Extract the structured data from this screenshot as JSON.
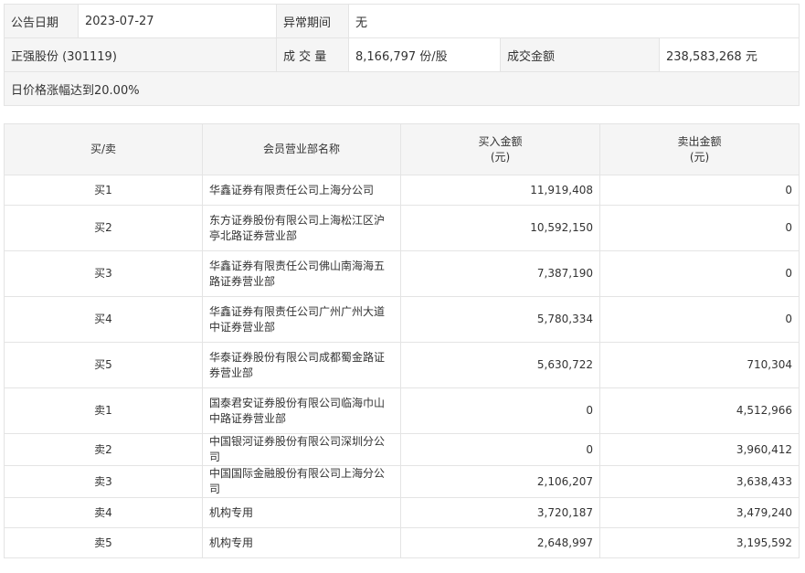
{
  "info": {
    "announce_date_label": "公告日期",
    "announce_date": "2023-07-27",
    "abnormal_period_label": "异常期间",
    "abnormal_period": "无",
    "stock": "正强股份 (301119)",
    "volume_label": "成 交 量",
    "volume": "8,166,797 份/股",
    "amount_label": "成交金额",
    "amount": "238,583,268 元",
    "reason": "日价格涨幅达到20.00%"
  },
  "trade_table": {
    "headers": {
      "side": "买/卖",
      "branch": "会员营业部名称",
      "buy_line1": "买入金额",
      "buy_line2": "(元)",
      "sell_line1": "卖出金额",
      "sell_line2": "(元)"
    },
    "rows": [
      {
        "side": "买1",
        "branch": "华鑫证券有限责任公司上海分公司",
        "buy": "11,919,408",
        "sell": "0"
      },
      {
        "side": "买2",
        "branch": "东方证券股份有限公司上海松江区沪亭北路证券营业部",
        "buy": "10,592,150",
        "sell": "0"
      },
      {
        "side": "买3",
        "branch": "华鑫证券有限责任公司佛山南海海五路证券营业部",
        "buy": "7,387,190",
        "sell": "0"
      },
      {
        "side": "买4",
        "branch": "华鑫证券有限责任公司广州广州大道中证券营业部",
        "buy": "5,780,334",
        "sell": "0"
      },
      {
        "side": "买5",
        "branch": "华泰证券股份有限公司成都蜀金路证券营业部",
        "buy": "5,630,722",
        "sell": "710,304"
      },
      {
        "side": "卖1",
        "branch": "国泰君安证券股份有限公司临海巾山中路证券营业部",
        "buy": "0",
        "sell": "4,512,966"
      },
      {
        "side": "卖2",
        "branch": "中国银河证券股份有限公司深圳分公司",
        "buy": "0",
        "sell": "3,960,412"
      },
      {
        "side": "卖3",
        "branch": "中国国际金融股份有限公司上海分公司",
        "buy": "2,106,207",
        "sell": "3,638,433"
      },
      {
        "side": "卖4",
        "branch": "机构专用",
        "buy": "3,720,187",
        "sell": "3,479,240"
      },
      {
        "side": "卖5",
        "branch": "机构专用",
        "buy": "2,648,997",
        "sell": "3,195,592"
      }
    ]
  }
}
